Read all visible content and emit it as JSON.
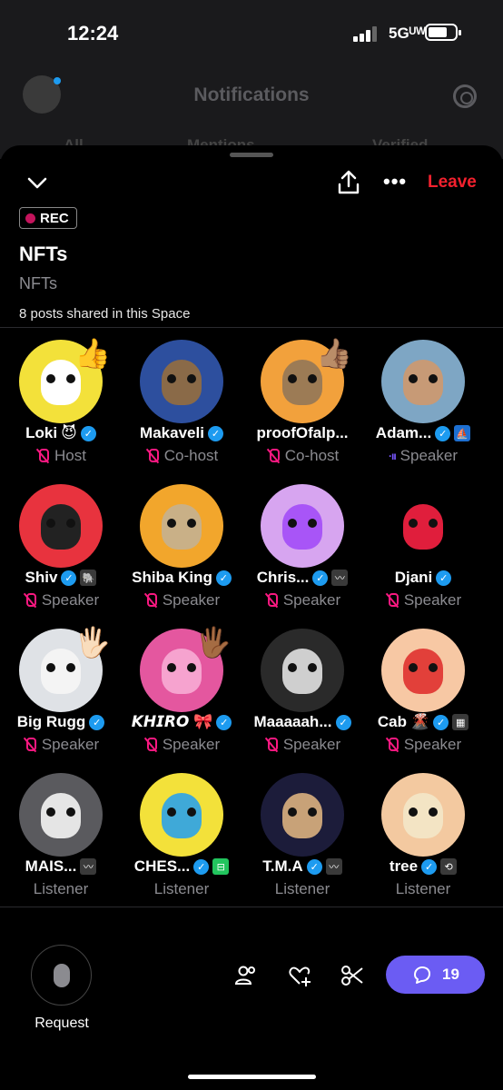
{
  "status_bar": {
    "time": "12:24",
    "network": "5Gᵁᵂ"
  },
  "background": {
    "title": "Notifications",
    "tabs": [
      "All",
      "Mentions",
      "Verified"
    ]
  },
  "space": {
    "leave_label": "Leave",
    "rec_label": "REC",
    "title": "NFTs",
    "subtitle": "NFTs",
    "posts_shared": "8 posts shared in this Space"
  },
  "participants": [
    {
      "name": "Loki",
      "emoji": "😈",
      "role": "Host",
      "muted": true,
      "verified": true,
      "reaction": "👍",
      "av_bg": "#f3e13a",
      "face": "#ffffff"
    },
    {
      "name": "Makaveli",
      "emoji": "",
      "role": "Co-host",
      "muted": true,
      "verified": true,
      "reaction": "",
      "av_bg": "#2d4f9e",
      "face": "#8a6a48"
    },
    {
      "name": "proofOfalp...",
      "emoji": "",
      "role": "Co-host",
      "muted": true,
      "verified": false,
      "reaction": "👍🏽",
      "av_bg": "#f2a13c",
      "face": "#9c7b55"
    },
    {
      "name": "Adam...",
      "emoji": "",
      "role": "Speaker",
      "muted": false,
      "verified": true,
      "reaction": "",
      "av_bg": "#7ea6c4",
      "face": "#c79a76",
      "extra": "⛵"
    },
    {
      "name": "Shiv",
      "emoji": "",
      "role": "Speaker",
      "muted": true,
      "verified": true,
      "reaction": "",
      "av_bg": "#e8333e",
      "face": "#222222",
      "extra": "🐘"
    },
    {
      "name": "Shiba King",
      "emoji": "",
      "role": "Speaker",
      "muted": true,
      "verified": true,
      "reaction": "",
      "av_bg": "#f2a62c",
      "face": "#c9b087"
    },
    {
      "name": "Chris...",
      "emoji": "",
      "role": "Speaker",
      "muted": true,
      "verified": true,
      "reaction": "",
      "av_bg": "#d7a5f0",
      "face": "#a855f7",
      "extra": "〰"
    },
    {
      "name": "Djani",
      "emoji": "",
      "role": "Speaker",
      "muted": true,
      "verified": true,
      "reaction": "",
      "av_bg": "#000000",
      "face": "#e01e3c"
    },
    {
      "name": "Big Rugg",
      "emoji": "",
      "role": "Speaker",
      "muted": true,
      "verified": true,
      "reaction": "🖐🏻",
      "av_bg": "#dfe2e6",
      "face": "#f4f4f4"
    },
    {
      "name": "𝙆𝙃𝙄𝙍𝙊 🎀",
      "emoji": "",
      "role": "Speaker",
      "muted": true,
      "verified": true,
      "reaction": "🖐🏾",
      "av_bg": "#e4579f",
      "face": "#f6a3cf"
    },
    {
      "name": "Maaaaah...",
      "emoji": "",
      "role": "Speaker",
      "muted": true,
      "verified": true,
      "reaction": "",
      "av_bg": "#2a2a2a",
      "face": "#cfcfcf"
    },
    {
      "name": "Cab",
      "emoji": "🌋",
      "role": "Speaker",
      "muted": true,
      "verified": true,
      "reaction": "",
      "av_bg": "#f7c8a4",
      "face": "#e2403a",
      "extra": "▦"
    },
    {
      "name": "MAIS...",
      "emoji": "",
      "role": "Listener",
      "muted": false,
      "verified": false,
      "reaction": "",
      "av_bg": "#5a5a5e",
      "face": "#e5e5e5",
      "extra": "〰"
    },
    {
      "name": "CHES...",
      "emoji": "",
      "role": "Listener",
      "muted": false,
      "verified": true,
      "reaction": "",
      "av_bg": "#f3e13a",
      "face": "#3fa9d8",
      "extra": "⊟"
    },
    {
      "name": "T.M.A",
      "emoji": "",
      "role": "Listener",
      "muted": false,
      "verified": true,
      "reaction": "",
      "av_bg": "#1c1c3a",
      "face": "#c8a278",
      "extra": "〰"
    },
    {
      "name": "tree",
      "emoji": "",
      "role": "Listener",
      "muted": false,
      "verified": true,
      "reaction": "",
      "av_bg": "#f3c9a0",
      "face": "#f3e4c4",
      "extra": "⟲"
    }
  ],
  "bottom": {
    "request_label": "Request",
    "comments_count": "19"
  },
  "colors": {
    "accent": "#1d9bf0",
    "leave": "#f4212e",
    "mute": "#f91880",
    "comments_btn": "#6b5cf3"
  }
}
